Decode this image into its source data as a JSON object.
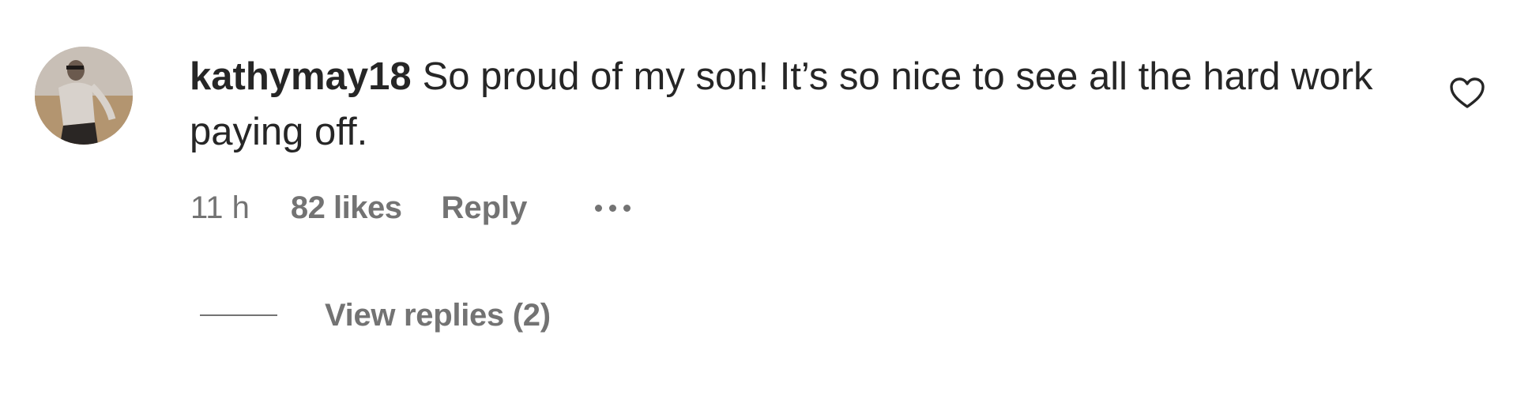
{
  "comment": {
    "username": "kathymay18",
    "text": "So proud of my son! It’s so nice to see all the hard work paying off.",
    "avatar_icon": "profile-photo",
    "like_icon": "heart-outline-icon"
  },
  "meta": {
    "time": "11 h",
    "likes": "82 likes",
    "reply_label": "Reply",
    "more_icon": "more-options-icon"
  },
  "replies": {
    "label": "View replies (2)"
  },
  "colors": {
    "text_primary": "#262626",
    "text_secondary": "#737373",
    "background": "#ffffff"
  }
}
